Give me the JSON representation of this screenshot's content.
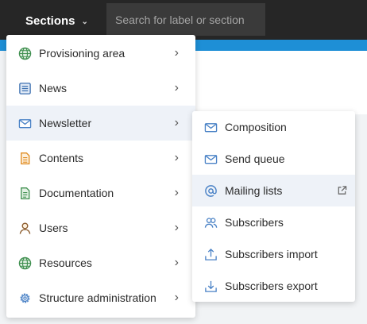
{
  "topbar": {
    "sections_label": "Sections",
    "search_placeholder": "Search for label or section"
  },
  "colors": {
    "topbar": "#262626",
    "accent": "#1e8fd6",
    "icon_blue": "#4a82c6",
    "icon_green": "#3f8f4f",
    "icon_orange": "#e08a1e"
  },
  "menu": {
    "items": [
      {
        "label": "Provisioning area",
        "icon": "globe-icon"
      },
      {
        "label": "News",
        "icon": "newspaper-icon"
      },
      {
        "label": "Newsletter",
        "icon": "mail-icon",
        "active": true
      },
      {
        "label": "Contents",
        "icon": "document-icon"
      },
      {
        "label": "Documentation",
        "icon": "document-text-icon"
      },
      {
        "label": "Users",
        "icon": "user-icon"
      },
      {
        "label": "Resources",
        "icon": "globe-icon"
      },
      {
        "label": "Structure administration",
        "icon": "gear-icon"
      }
    ]
  },
  "submenu": {
    "items": [
      {
        "label": "Composition",
        "icon": "mail-icon"
      },
      {
        "label": "Send queue",
        "icon": "mail-icon"
      },
      {
        "label": "Mailing lists",
        "icon": "at-sign-icon",
        "active": true,
        "external": true
      },
      {
        "label": "Subscribers",
        "icon": "users-icon"
      },
      {
        "label": "Subscribers import",
        "icon": "upload-icon"
      },
      {
        "label": "Subscribers export",
        "icon": "download-icon"
      }
    ]
  }
}
